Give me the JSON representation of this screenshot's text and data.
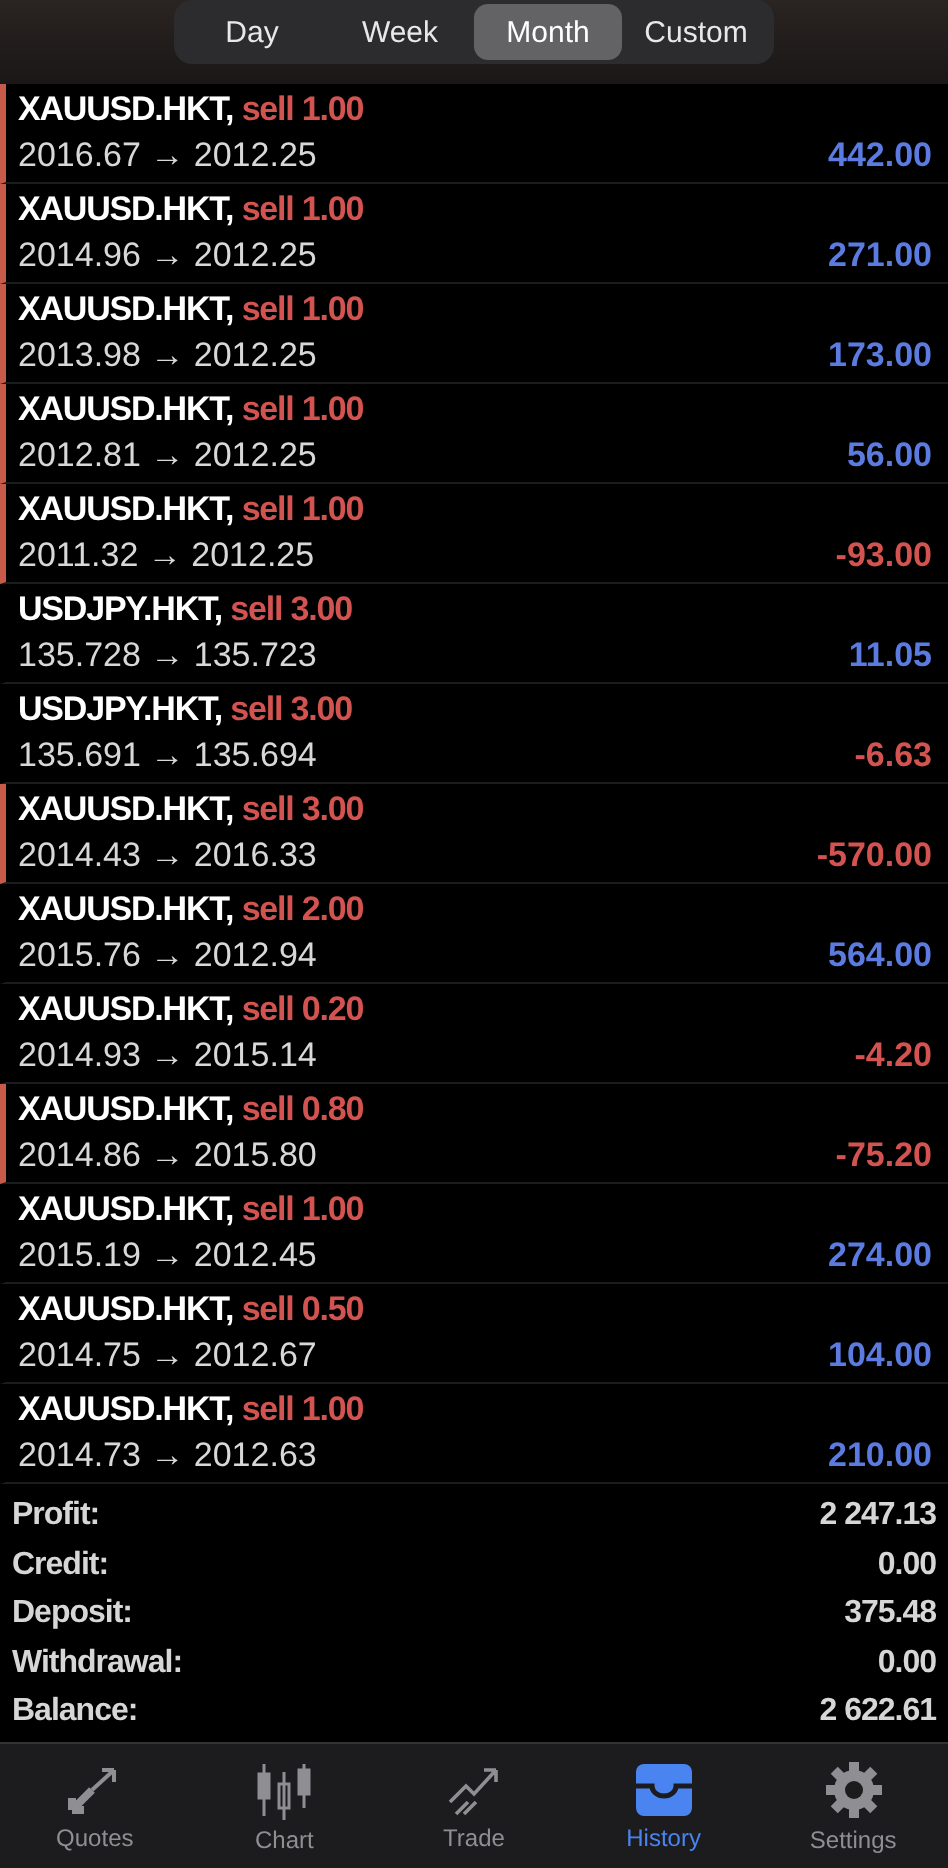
{
  "periods": [
    {
      "label": "Day",
      "selected": false
    },
    {
      "label": "Week",
      "selected": false
    },
    {
      "label": "Month",
      "selected": true
    },
    {
      "label": "Custom",
      "selected": false
    }
  ],
  "deals": [
    {
      "symbol": "XAUUSD.HKT,",
      "side": "sell 1.00",
      "prices": "2016.67 → 2012.25",
      "profit": "442.00",
      "loss": false,
      "marked": true
    },
    {
      "symbol": "XAUUSD.HKT,",
      "side": "sell 1.00",
      "prices": "2014.96 → 2012.25",
      "profit": "271.00",
      "loss": false,
      "marked": true
    },
    {
      "symbol": "XAUUSD.HKT,",
      "side": "sell 1.00",
      "prices": "2013.98 → 2012.25",
      "profit": "173.00",
      "loss": false,
      "marked": true
    },
    {
      "symbol": "XAUUSD.HKT,",
      "side": "sell 1.00",
      "prices": "2012.81 → 2012.25",
      "profit": "56.00",
      "loss": false,
      "marked": true
    },
    {
      "symbol": "XAUUSD.HKT,",
      "side": "sell 1.00",
      "prices": "2011.32 → 2012.25",
      "profit": "-93.00",
      "loss": true,
      "marked": true
    },
    {
      "symbol": "USDJPY.HKT,",
      "side": "sell 3.00",
      "prices": "135.728 → 135.723",
      "profit": "11.05",
      "loss": false,
      "marked": false
    },
    {
      "symbol": "USDJPY.HKT,",
      "side": "sell 3.00",
      "prices": "135.691 → 135.694",
      "profit": "-6.63",
      "loss": true,
      "marked": false
    },
    {
      "symbol": "XAUUSD.HKT,",
      "side": "sell 3.00",
      "prices": "2014.43 → 2016.33",
      "profit": "-570.00",
      "loss": true,
      "marked": true
    },
    {
      "symbol": "XAUUSD.HKT,",
      "side": "sell 2.00",
      "prices": "2015.76 → 2012.94",
      "profit": "564.00",
      "loss": false,
      "marked": false
    },
    {
      "symbol": "XAUUSD.HKT,",
      "side": "sell 0.20",
      "prices": "2014.93 → 2015.14",
      "profit": "-4.20",
      "loss": true,
      "marked": false
    },
    {
      "symbol": "XAUUSD.HKT,",
      "side": "sell 0.80",
      "prices": "2014.86 → 2015.80",
      "profit": "-75.20",
      "loss": true,
      "marked": true
    },
    {
      "symbol": "XAUUSD.HKT,",
      "side": "sell 1.00",
      "prices": "2015.19 → 2012.45",
      "profit": "274.00",
      "loss": false,
      "marked": false
    },
    {
      "symbol": "XAUUSD.HKT,",
      "side": "sell 0.50",
      "prices": "2014.75 → 2012.67",
      "profit": "104.00",
      "loss": false,
      "marked": false
    },
    {
      "symbol": "XAUUSD.HKT,",
      "side": "sell 1.00",
      "prices": "2014.73 → 2012.63",
      "profit": "210.00",
      "loss": false,
      "marked": false
    }
  ],
  "summary": [
    {
      "label": "Profit:",
      "value": "2 247.13"
    },
    {
      "label": "Credit:",
      "value": "0.00"
    },
    {
      "label": "Deposit:",
      "value": "375.48"
    },
    {
      "label": "Withdrawal:",
      "value": "0.00"
    },
    {
      "label": "Balance:",
      "value": "2 622.61"
    }
  ],
  "tabbar": [
    {
      "label": "Quotes",
      "kind": "quotes",
      "selected": false
    },
    {
      "label": "Chart",
      "kind": "chart",
      "selected": false
    },
    {
      "label": "Trade",
      "kind": "trade",
      "selected": false
    },
    {
      "label": "History",
      "kind": "history",
      "selected": true
    },
    {
      "label": "Settings",
      "kind": "settings",
      "selected": false
    }
  ]
}
